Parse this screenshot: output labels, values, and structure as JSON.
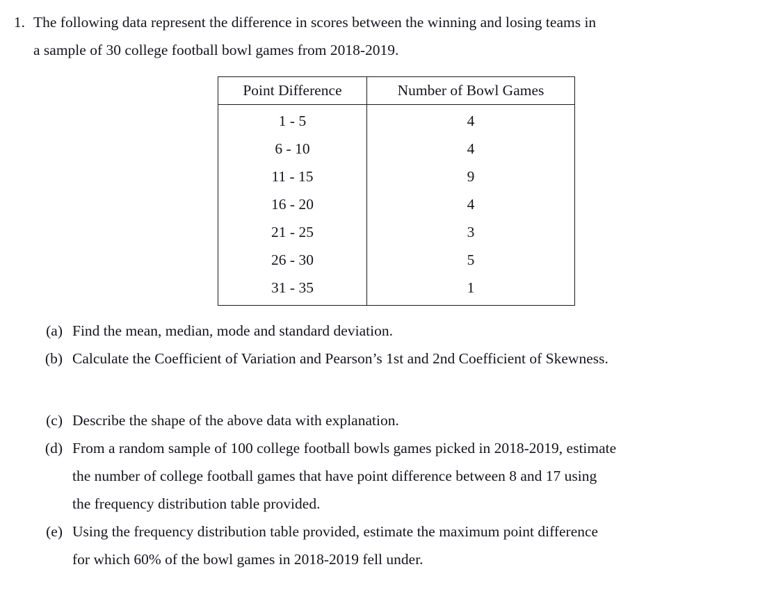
{
  "problem": {
    "marker": "1.",
    "statement_lines": [
      "The following data represent the difference in scores between the winning and losing teams in",
      "a sample of 30 college football bowl games from 2018-2019."
    ]
  },
  "table": {
    "headers": [
      "Point Difference",
      "Number of Bowl Games"
    ],
    "rows": [
      {
        "interval": "1 - 5",
        "frequency": "4"
      },
      {
        "interval": "6 - 10",
        "frequency": "4"
      },
      {
        "interval": "11 - 15",
        "frequency": "9"
      },
      {
        "interval": "16 - 20",
        "frequency": "4"
      },
      {
        "interval": "21 - 25",
        "frequency": "3"
      },
      {
        "interval": "26 - 30",
        "frequency": "5"
      },
      {
        "interval": "31 - 35",
        "frequency": "1"
      }
    ]
  },
  "subitems": [
    {
      "marker": "(a)",
      "lines": [
        "Find the mean, median, mode and standard deviation."
      ]
    },
    {
      "marker": "(b)",
      "lines": [
        "Calculate the Coefficient of Variation and Pearson’s 1st and 2nd Coefficient of Skewness."
      ]
    },
    {
      "marker": "(c)",
      "lines": [
        "Describe the shape of the above data with explanation."
      ]
    },
    {
      "marker": "(d)",
      "lines": [
        "From a random sample of 100 college football bowls games picked in 2018-2019, estimate",
        "the number of college football games that have point difference between 8 and 17 using",
        "the frequency distribution table provided."
      ]
    },
    {
      "marker": "(e)",
      "lines": [
        "Using the frequency distribution table provided, estimate the maximum point difference",
        "for which 60% of the bowl games in 2018-2019 fell under."
      ]
    }
  ],
  "chart_data": {
    "type": "table",
    "title": "Point difference between winning and losing teams, 30 college football bowl games 2018-2019",
    "categories": [
      "1 - 5",
      "6 - 10",
      "11 - 15",
      "16 - 20",
      "21 - 25",
      "26 - 30",
      "31 - 35"
    ],
    "values": [
      4,
      4,
      9,
      4,
      3,
      5,
      1
    ],
    "xlabel": "Point Difference",
    "ylabel": "Number of Bowl Games",
    "total": 30
  }
}
